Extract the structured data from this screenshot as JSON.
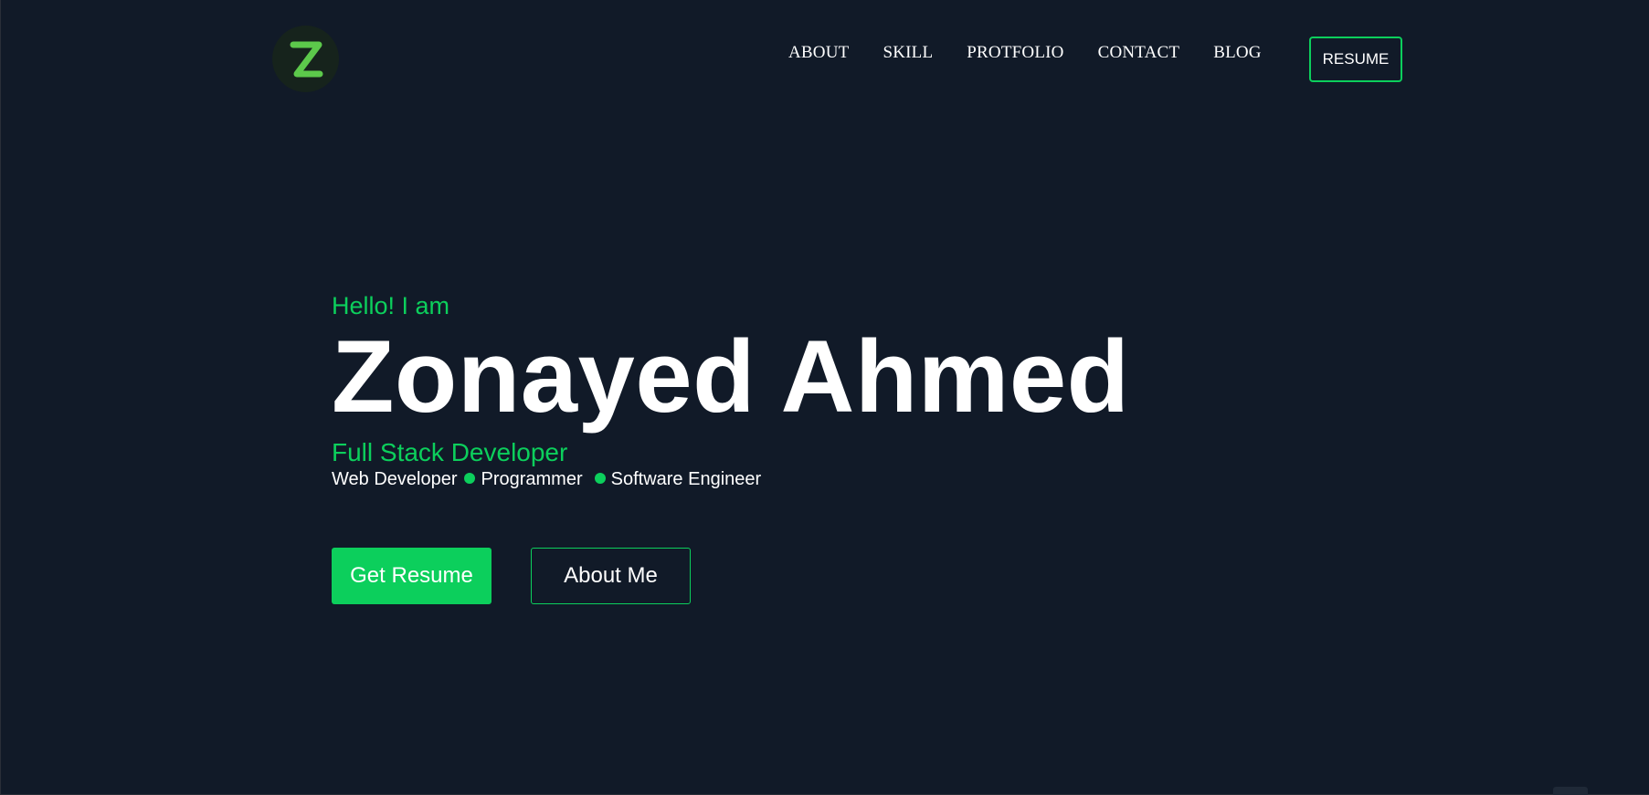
{
  "logo": {
    "letter": "Z",
    "accent": "#5cc94b"
  },
  "nav": {
    "items": [
      {
        "label": "ABOUT"
      },
      {
        "label": "SKILL"
      },
      {
        "label": "PROTFOLIO"
      },
      {
        "label": "CONTACT"
      },
      {
        "label": "BLOG"
      }
    ],
    "resume_label": "RESUME"
  },
  "hero": {
    "greeting": "Hello! I am",
    "name": "Zonayed Ahmed",
    "role": "Full Stack Developer",
    "tags": [
      "Web Developer",
      "Programmer",
      "Software Engineer"
    ],
    "primary_button": "Get Resume",
    "secondary_button": "About Me"
  },
  "colors": {
    "background": "#111a28",
    "accent": "#0ccf5c",
    "text": "#ffffff"
  }
}
